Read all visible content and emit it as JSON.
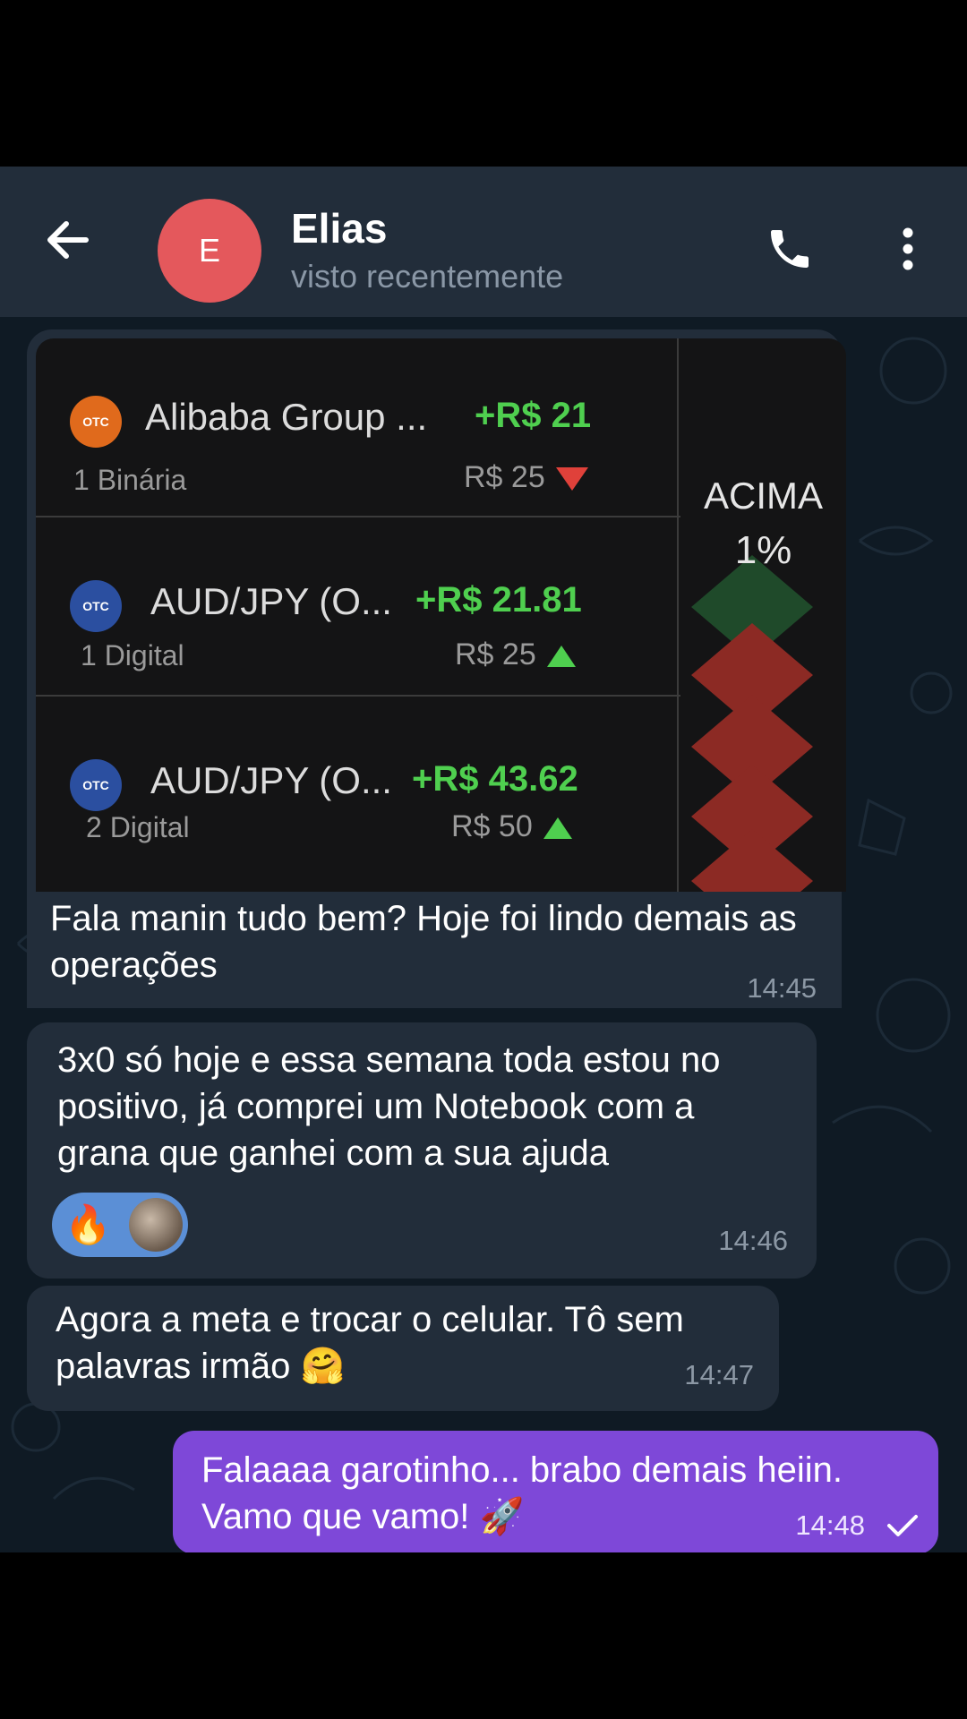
{
  "header": {
    "avatar_letter": "E",
    "avatar_color": "#e4585c",
    "contact_name": "Elias",
    "contact_status": "visto recentemente"
  },
  "image_message": {
    "trades": [
      {
        "icon": "alibaba-icon",
        "name": "Alibaba Group ...",
        "profit": "+R$ 21",
        "type": "1 Binária",
        "stake": "R$ 25",
        "direction": "down"
      },
      {
        "icon": "aud-jpy-flag-icon",
        "name": "AUD/JPY (O...",
        "profit": "+R$ 21.81",
        "type": "1 Digital",
        "stake": "R$ 25",
        "direction": "up"
      },
      {
        "icon": "aud-jpy-flag-icon",
        "name": "AUD/JPY (O...",
        "profit": "+R$ 43.62",
        "type": "2 Digital",
        "stake": "R$ 50",
        "direction": "up"
      }
    ],
    "side_label": "ACIMA",
    "side_percent": "1%",
    "caption": "Fala manin tudo bem? Hoje foi lindo demais as operações",
    "time": "14:45"
  },
  "messages": [
    {
      "text": "3x0 só hoje e essa semana toda estou no positivo, já comprei um Notebook com a grana que ganhei com a sua ajuda",
      "time": "14:46",
      "reaction": "🔥"
    },
    {
      "text": "Agora a meta e trocar o celular. Tô sem palavras irmão 🤗",
      "time": "14:47"
    },
    {
      "text": "Falaaaa garotinho... brabo demais heiin. Vamo que vamo! 🚀",
      "time": "14:48",
      "status": "sent"
    }
  ],
  "colors": {
    "header_bg": "#222d3a",
    "chat_bg": "#0f1a24",
    "incoming_bubble": "#222d3a",
    "outgoing_bubble": "#7e48d8",
    "profit_green": "#4fcf4f",
    "loss_red": "#e0413a"
  }
}
